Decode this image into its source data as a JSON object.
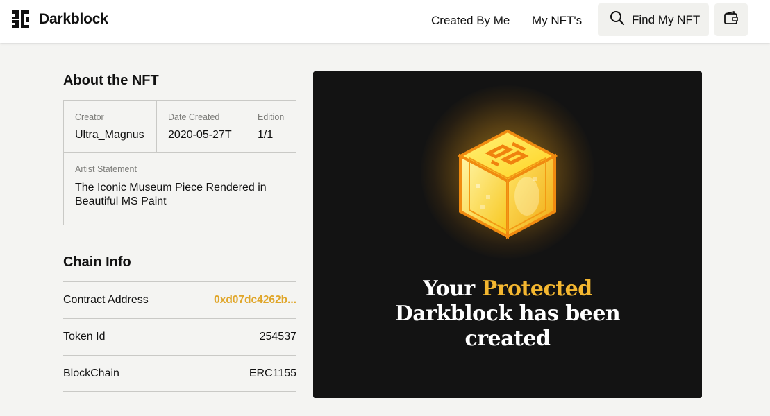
{
  "header": {
    "brand": "Darkblock",
    "nav": {
      "created_by_me": "Created By Me",
      "my_nfts": "My NFT's",
      "find_my_nft": "Find My NFT"
    }
  },
  "about": {
    "title": "About the NFT",
    "creator_label": "Creator",
    "creator_value": "Ultra_Magnus",
    "date_label": "Date Created",
    "date_value": "2020-05-27T",
    "edition_label": "Edition",
    "edition_value": "1/1",
    "artist_label": "Artist Statement",
    "artist_value": "The Iconic Museum Piece Rendered in Beautiful MS Paint"
  },
  "chain": {
    "title": "Chain Info",
    "rows": [
      {
        "label": "Contract Address",
        "value": "0xd07dc4262b..."
      },
      {
        "label": "Token Id",
        "value": "254537"
      },
      {
        "label": "BlockChain",
        "value": "ERC1155"
      }
    ]
  },
  "preview": {
    "line1_a": "Your ",
    "line1_b": "Protected",
    "line2": "Darkblock has been",
    "line3": "created"
  },
  "colors": {
    "accent": "#f4b730",
    "address": "#e0a62a",
    "preview_bg": "#131313"
  },
  "icons": [
    "darkblock-logo-icon",
    "search-icon",
    "wallet-icon",
    "darkblock-cube-icon"
  ]
}
